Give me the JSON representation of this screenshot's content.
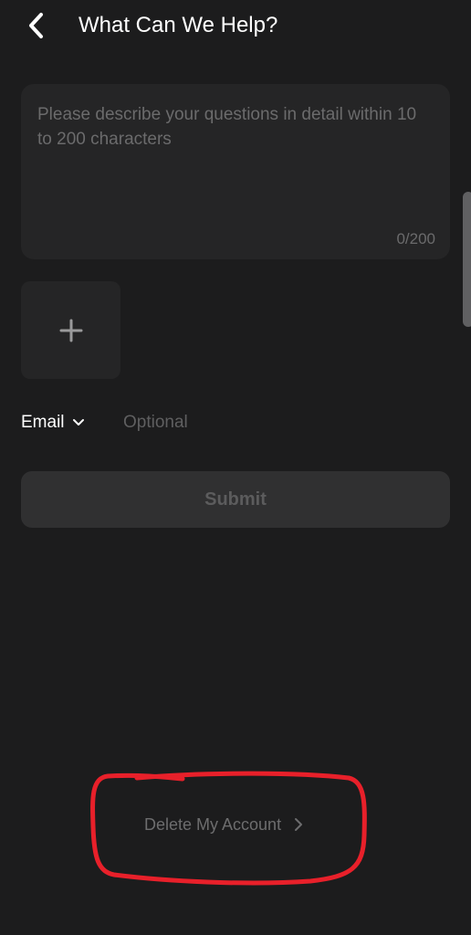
{
  "header": {
    "title": "What Can We Help?",
    "back_icon": "chevron-left-icon"
  },
  "feedback_form": {
    "description_placeholder": "Please describe your questions in detail within 10 to 200 characters",
    "char_counter": "0/200",
    "add_image_icon": "plus-icon",
    "contact_type_label": "Email",
    "contact_type_icon": "chevron-down-icon",
    "contact_placeholder": "Optional",
    "submit_label": "Submit"
  },
  "footer": {
    "delete_account_label": "Delete My Account",
    "delete_account_icon": "chevron-right-icon"
  },
  "colors": {
    "background": "#1c1c1d",
    "field_background": "#252526",
    "button_background": "#303031",
    "annotation_red": "#e8202a",
    "text_primary": "#ffffff",
    "text_muted": "#6b6b6c"
  }
}
